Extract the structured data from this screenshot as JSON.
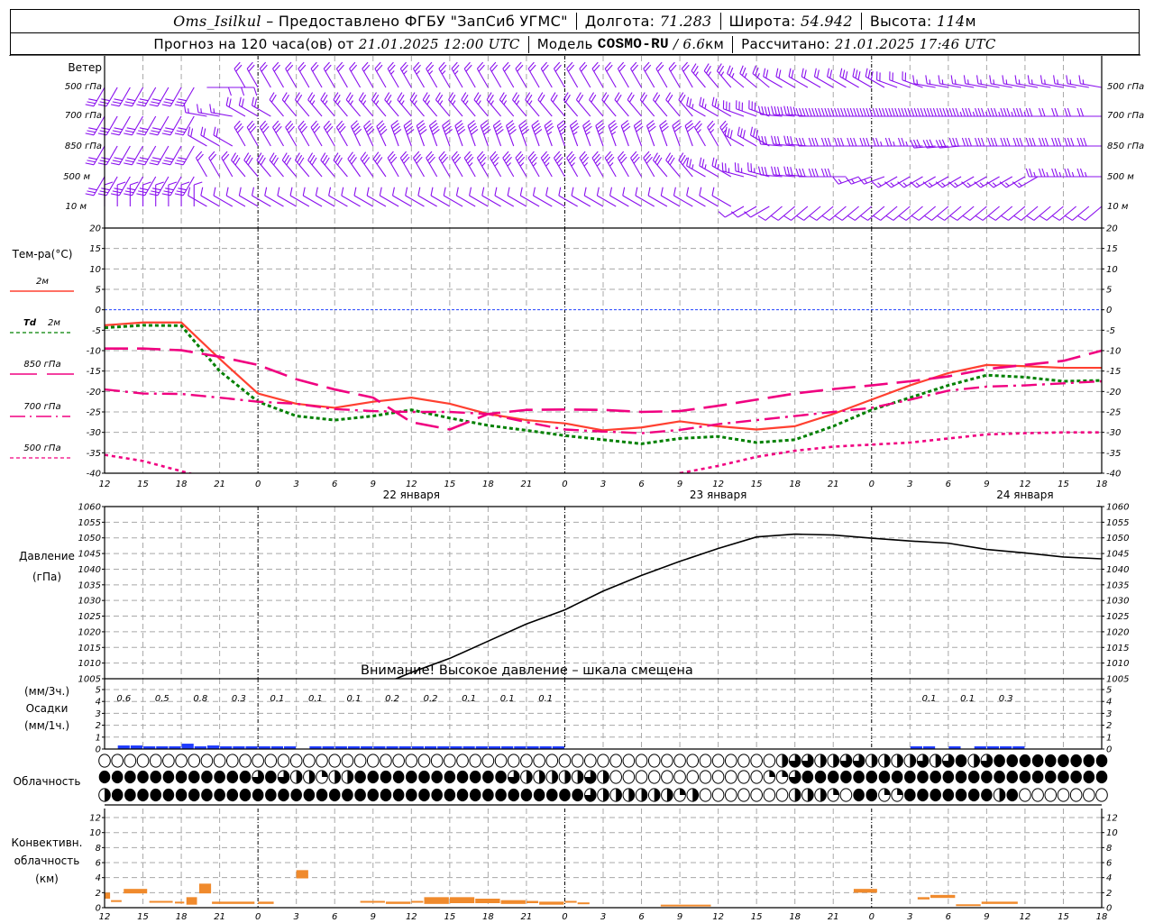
{
  "header": {
    "station": "Oms_Isilkul",
    "provider": " – Предоставлено ФГБУ \"ЗапСиб УГМС\"",
    "lon_label": "Долгота: ",
    "lon": "71.283",
    "lat_label": "Широта: ",
    "lat": "54.942",
    "alt_label": "Высота: ",
    "alt": "114",
    "alt_unit": "м",
    "forecast_label": "Прогноз на 120 часа(ов) от ",
    "forecast_time": "21.01.2025 12:00 UTC",
    "model_label": "Модель ",
    "model": "COSMO-RU",
    "model_res": " / 6.6",
    "model_res_unit": "км",
    "calc_label": "Рассчитано: ",
    "calc_time": "21.01.2025 17:46 UTC"
  },
  "labels": {
    "wind": "Ветер",
    "lvl500": "500 гПа",
    "lvl700": "700 гПа",
    "lvl850": "850 гПа",
    "lvl500m": "500 м",
    "lvl10m": "10 м",
    "temp": "Тем-ра(°C)",
    "t2m": "2м",
    "td": "Td",
    "td2m": "2м",
    "t850": "850 гПа",
    "t700": "700 гПа",
    "t500": "500 гПа",
    "pressure": "Давление",
    "pressure_unit": "(гПа)",
    "precip_3h": "(мм/3ч.)",
    "precip": "Осадки",
    "precip_1h": "(мм/1ч.)",
    "clouds": "Облачность",
    "conv1": "Конвективн.",
    "conv2": "облачность",
    "conv3": "(км)",
    "warning": "Внимание! Высокое давление – шкала смещена"
  },
  "colors": {
    "t2m": "#ff4030",
    "td": "#008000",
    "upper": "#f00080",
    "wind": "#8a10ee",
    "precip": "#1f3cff",
    "conv": "#f08a2c",
    "zero": "#2040ff",
    "grid": "#a8a8a8"
  },
  "chart_data": {
    "type": "line",
    "x_unit": "hours from 21.01.2025 12:00 UTC",
    "x_hours": [
      0,
      3,
      6,
      9,
      12,
      15,
      18,
      21,
      24,
      27,
      30,
      33,
      36,
      39,
      42,
      45,
      48,
      51,
      54,
      57,
      60,
      63,
      66,
      69,
      72,
      75,
      78
    ],
    "x_tick_labels": [
      "12",
      "15",
      "18",
      "21",
      "0",
      "3",
      "6",
      "9",
      "12",
      "15",
      "18",
      "21",
      "0",
      "3",
      "6",
      "9",
      "12",
      "15",
      "18",
      "21",
      "0",
      "3",
      "6",
      "9",
      "12",
      "15",
      "18"
    ],
    "day_labels": [
      {
        "hour": 24,
        "text": "22 января"
      },
      {
        "hour": 48,
        "text": "23 января"
      },
      {
        "hour": 72,
        "text": "24 января"
      }
    ],
    "temperature": {
      "ylim": [
        -40,
        20
      ],
      "ticks": [
        20,
        15,
        10,
        5,
        0,
        -5,
        -10,
        -15,
        -20,
        -25,
        -30,
        -35,
        -40
      ],
      "series": [
        {
          "name": "2м",
          "key": "t2m",
          "values": [
            -3.8,
            -3.1,
            -3.1,
            -12,
            -20.5,
            -23,
            -24,
            -22.5,
            -21.5,
            -23,
            -25.5,
            -27,
            -27.8,
            -29.5,
            -28.8,
            -27.3,
            -28.5,
            -29.3,
            -28.5,
            -25.5,
            -22,
            -18.5,
            -15.5,
            -13.5,
            -13.8,
            -14.2,
            -14.2
          ]
        },
        {
          "name": "Td 2м",
          "key": "td",
          "values": [
            -4.4,
            -3.8,
            -3.9,
            -15,
            -22.5,
            -26,
            -27,
            -26,
            -24.5,
            -26.5,
            -28.3,
            -29.5,
            -30.8,
            -31.8,
            -32.8,
            -31.5,
            -31,
            -32.5,
            -31.8,
            -28.5,
            -24.5,
            -21.5,
            -18.5,
            -16,
            -16.5,
            -17.5,
            -17.3
          ]
        },
        {
          "name": "850 гПа",
          "key": "t850",
          "values": [
            -9.5,
            -9.5,
            -9.9,
            -11.5,
            -13.5,
            -17,
            -19.5,
            -21.5,
            -27.5,
            -29.3,
            -25.5,
            -24.5,
            -24.4,
            -24.5,
            -25,
            -24.8,
            -23.5,
            -22,
            -20.5,
            -19.4,
            -18.5,
            -17.5,
            -16.3,
            -14.5,
            -13.5,
            -12.5,
            -10
          ]
        },
        {
          "name": "700 гПа",
          "key": "t700",
          "values": [
            -19.5,
            -20.5,
            -20.6,
            -21.5,
            -22.5,
            -23,
            -24.3,
            -24.8,
            -25,
            -25,
            -25.5,
            -27.5,
            -29.3,
            -29.8,
            -30.2,
            -29.4,
            -28,
            -27,
            -26,
            -25,
            -24,
            -22,
            -19.8,
            -18.8,
            -18.5,
            -18,
            -17.5
          ]
        },
        {
          "name": "500 гПа",
          "key": "t500",
          "values": [
            -35.5,
            -37,
            -39.5,
            -42,
            null,
            null,
            null,
            null,
            null,
            null,
            null,
            null,
            null,
            null,
            null,
            -40,
            -38.2,
            -36,
            -34.5,
            -33.5,
            -33,
            -32.5,
            -31.5,
            -30.5,
            -30.2,
            -30,
            -30
          ]
        }
      ]
    },
    "pressure": {
      "ylim": [
        1005,
        1060
      ],
      "ticks": [
        1060,
        1055,
        1050,
        1045,
        1040,
        1035,
        1030,
        1025,
        1020,
        1015,
        1010,
        1005
      ],
      "values": [
        null,
        null,
        null,
        1002,
        1007,
        1011.5,
        1017,
        1022.5,
        1027,
        1033,
        1038,
        1042.5,
        1046.6,
        1050.3,
        1051.2,
        1050.9,
        1049.9,
        1049,
        1048.3,
        1046.3,
        1045.2,
        1043.9,
        1043.3
      ]
    },
    "pressure_hours": [
      12,
      15,
      18,
      21,
      24,
      27,
      30,
      33,
      36,
      39,
      42,
      45,
      48,
      51,
      54,
      57,
      60,
      63,
      66,
      69,
      72,
      75,
      78
    ],
    "precipitation": {
      "ylim": [
        0,
        5
      ],
      "ticks": [
        0,
        1,
        2,
        3,
        4,
        5
      ],
      "hourly_mm": [
        0,
        0.3,
        0.3,
        0.17,
        0.17,
        0.17,
        0.45,
        0.15,
        0.3,
        0.15,
        0.15,
        0.05,
        0.05,
        0.05,
        0.05,
        0,
        0.05,
        0.05,
        0.05,
        0.05,
        0.1,
        0.1,
        0.1,
        0.15,
        0.15,
        0.1,
        0.1,
        0.1,
        0.1,
        0.1,
        0.05,
        0.05,
        0.05,
        0.1,
        0.05,
        0.05,
        0,
        0,
        0,
        0,
        0,
        0,
        0,
        0,
        0,
        0,
        0,
        0,
        0,
        0,
        0,
        0,
        0,
        0,
        0,
        0,
        0,
        0,
        0,
        0,
        0,
        0,
        0,
        0.05,
        0.05,
        0,
        0.05,
        0,
        0.05,
        0.15,
        0.15,
        0.1,
        0,
        0,
        0,
        0,
        0,
        0
      ],
      "sums_3h": [
        {
          "block": 0,
          "text": "0.6"
        },
        {
          "block": 1,
          "text": "0.5"
        },
        {
          "block": 2,
          "text": "0.8"
        },
        {
          "block": 3,
          "text": "0.3"
        },
        {
          "block": 4,
          "text": "0.1"
        },
        {
          "block": 5,
          "text": "0.1"
        },
        {
          "block": 6,
          "text": "0.1"
        },
        {
          "block": 7,
          "text": "0.2"
        },
        {
          "block": 8,
          "text": "0.2"
        },
        {
          "block": 9,
          "text": "0.1"
        },
        {
          "block": 10,
          "text": "0.1"
        },
        {
          "block": 11,
          "text": "0.1"
        },
        {
          "block": 21,
          "text": "0.1"
        },
        {
          "block": 22,
          "text": "0.1"
        },
        {
          "block": 23,
          "text": "0.3"
        }
      ]
    },
    "cloud_cover_quarters": {
      "upper": "0000000000000000000000000000000000000000000000000000023322332222323423444444444",
      "middle": "4444444444443432212244444444444432222232000000000000113444444444444444444444444",
      "lower": "2444444444444444444444444444444444444432222221200000002221044114444444240000000"
    },
    "convective_clouds": {
      "ylim": [
        0,
        12
      ],
      "ticks": [
        0,
        2,
        4,
        6,
        8,
        10,
        12
      ],
      "bars_km": [
        [
          0,
          0.5,
          1.2,
          2.0
        ],
        [
          0.5,
          1.4,
          0.8,
          1.0
        ],
        [
          1.5,
          3.4,
          1.9,
          2.5
        ],
        [
          3.5,
          5.4,
          0.7,
          0.9
        ],
        [
          5.5,
          6.3,
          0.6,
          0.8
        ],
        [
          6.4,
          7.3,
          0.4,
          1.4
        ],
        [
          7.4,
          8.4,
          1.9,
          3.2
        ],
        [
          8.4,
          11.8,
          0.5,
          0.8
        ],
        [
          12,
          13.3,
          0.5,
          0.8
        ],
        [
          15,
          16,
          3.9,
          5.0
        ],
        [
          20,
          22,
          0.7,
          0.9
        ],
        [
          22,
          24,
          0.5,
          0.8
        ],
        [
          24,
          25,
          0.7,
          0.9
        ],
        [
          25,
          27,
          0.5,
          1.4
        ],
        [
          27,
          29,
          0.6,
          1.4
        ],
        [
          29,
          31,
          0.6,
          1.2
        ],
        [
          31,
          33,
          0.5,
          1.0
        ],
        [
          33,
          34,
          0.6,
          0.9
        ],
        [
          34,
          36,
          0.4,
          0.8
        ],
        [
          36,
          37,
          0.7,
          0.9
        ],
        [
          37,
          38,
          0.5,
          0.7
        ],
        [
          43.5,
          47.5,
          0.3,
          0.4
        ],
        [
          58.6,
          60.5,
          2.0,
          2.5
        ],
        [
          63.6,
          64.6,
          1.1,
          1.4
        ],
        [
          64.6,
          66.6,
          1.3,
          1.7
        ],
        [
          66.6,
          68.6,
          0.35,
          0.45
        ],
        [
          68.6,
          71.5,
          0.5,
          0.8
        ]
      ]
    },
    "wind": {
      "unit": "m/s; dir = screen direction of barb staff from station (deg, 0=up)",
      "levels": [
        {
          "key": "500hPa",
          "dir": [
            210,
            210,
            210,
            90,
            330,
            330,
            330,
            330,
            330,
            330,
            330,
            330,
            330,
            330,
            330,
            330,
            320,
            310,
            300,
            300,
            300,
            290,
            280,
            280,
            280,
            280,
            280
          ],
          "speed": [
            15,
            15,
            15,
            5,
            10,
            10,
            10,
            10,
            12,
            12,
            10,
            10,
            10,
            10,
            10,
            10,
            12,
            12,
            10,
            10,
            15,
            10,
            8,
            8,
            8,
            8,
            8
          ]
        },
        {
          "key": "700hPa",
          "dir": [
            210,
            210,
            210,
            280,
            300,
            320,
            320,
            320,
            320,
            320,
            320,
            320,
            320,
            320,
            320,
            320,
            300,
            290,
            275,
            270,
            270,
            270,
            270,
            270,
            270,
            270,
            270
          ],
          "speed": [
            15,
            15,
            15,
            8,
            10,
            10,
            12,
            12,
            12,
            12,
            12,
            12,
            10,
            10,
            10,
            10,
            12,
            15,
            20,
            20,
            20,
            20,
            20,
            18,
            18,
            10,
            10
          ]
        },
        {
          "key": "850hPa",
          "dir": [
            210,
            210,
            210,
            300,
            330,
            330,
            330,
            335,
            340,
            340,
            340,
            340,
            340,
            340,
            340,
            340,
            330,
            300,
            275,
            270,
            270,
            270,
            265,
            270,
            270,
            270,
            270
          ],
          "speed": [
            15,
            15,
            15,
            10,
            15,
            15,
            15,
            20,
            20,
            20,
            20,
            20,
            18,
            18,
            15,
            15,
            12,
            15,
            15,
            15,
            15,
            12,
            15,
            15,
            15,
            15,
            15
          ]
        },
        {
          "key": "500m",
          "dir": [
            210,
            210,
            210,
            330,
            320,
            320,
            320,
            325,
            330,
            330,
            330,
            330,
            330,
            330,
            330,
            320,
            300,
            285,
            275,
            270,
            250,
            240,
            240,
            240,
            240,
            270,
            270
          ],
          "speed": [
            15,
            15,
            15,
            10,
            15,
            15,
            15,
            15,
            15,
            15,
            18,
            18,
            18,
            18,
            15,
            15,
            12,
            12,
            15,
            15,
            8,
            8,
            8,
            8,
            8,
            12,
            12
          ]
        },
        {
          "key": "10m",
          "dir": [
            0,
            0,
            0,
            300,
            300,
            300,
            300,
            300,
            300,
            300,
            300,
            300,
            300,
            300,
            300,
            300,
            300,
            240,
            230,
            230,
            230,
            230,
            230,
            230,
            230,
            230,
            230
          ],
          "speed": [
            5,
            5,
            5,
            5,
            5,
            5,
            5,
            5,
            5,
            5,
            5,
            5,
            5,
            5,
            5,
            5,
            5,
            5,
            5,
            5,
            5,
            5,
            5,
            5,
            5,
            5,
            5
          ]
        }
      ]
    }
  }
}
